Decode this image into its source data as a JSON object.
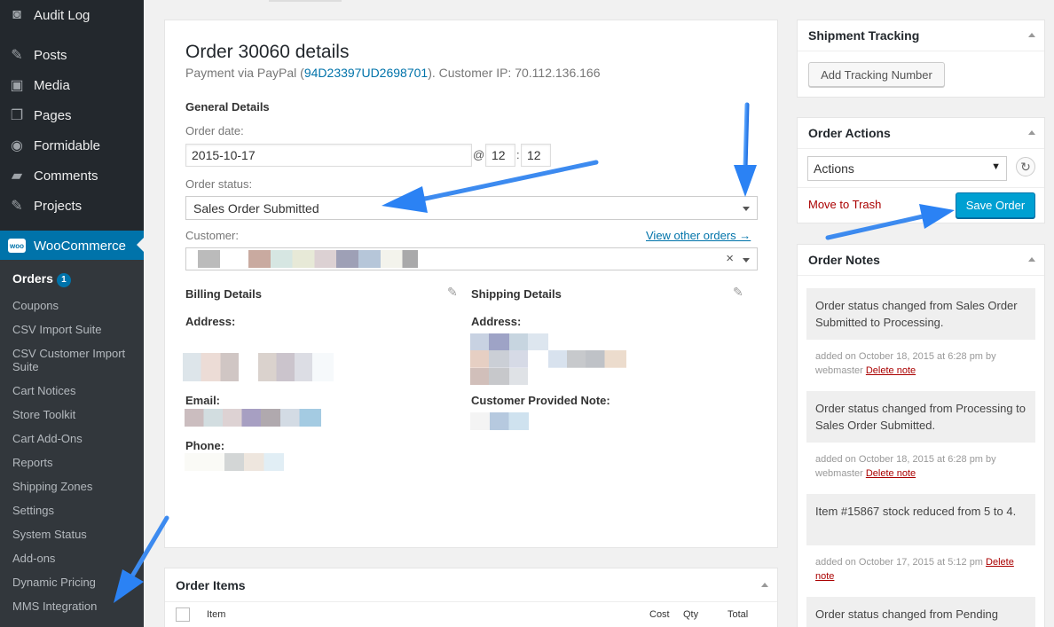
{
  "sidebar": {
    "items": [
      {
        "label": "Audit Log",
        "icon": "audit-log-icon"
      },
      {
        "label": "Posts",
        "icon": "pin-icon"
      },
      {
        "label": "Media",
        "icon": "media-icon"
      },
      {
        "label": "Pages",
        "icon": "pages-icon"
      },
      {
        "label": "Formidable",
        "icon": "formidable-icon"
      },
      {
        "label": "Comments",
        "icon": "comments-icon"
      },
      {
        "label": "Projects",
        "icon": "pin-icon"
      },
      {
        "label": "WooCommerce",
        "icon": "woo-icon"
      }
    ],
    "submenu": [
      {
        "label": "Orders",
        "badge": "1"
      },
      {
        "label": "Coupons"
      },
      {
        "label": "CSV Import Suite"
      },
      {
        "label": "CSV Customer Import Suite"
      },
      {
        "label": "Cart Notices"
      },
      {
        "label": "Store Toolkit"
      },
      {
        "label": "Cart Add-Ons"
      },
      {
        "label": "Reports"
      },
      {
        "label": "Shipping Zones"
      },
      {
        "label": "Settings"
      },
      {
        "label": "System Status"
      },
      {
        "label": "Add-ons"
      },
      {
        "label": "Dynamic Pricing"
      },
      {
        "label": "MMS Integration"
      }
    ]
  },
  "order": {
    "title": "Order 30060 details",
    "payment_prefix": "Payment via PayPal (",
    "payment_txn": "94D23397UD2698701",
    "payment_suffix": "). Customer IP: 70.112.136.166",
    "general_heading": "General Details",
    "order_date_label": "Order date:",
    "order_date": "2015-10-17",
    "at": "@",
    "hour": "12",
    "colon": ":",
    "minute": "12",
    "status_label": "Order status:",
    "status_value": "Sales Order Submitted",
    "customer_label": "Customer:",
    "view_other_orders": "View other orders →",
    "customer_clear": "×",
    "billing_heading": "Billing Details",
    "shipping_heading": "Shipping Details",
    "billing_address_label": "Address:",
    "billing_email_label": "Email:",
    "billing_phone_label": "Phone:",
    "shipping_address_label": "Address:",
    "shipping_note_label": "Customer Provided Note:"
  },
  "order_items": {
    "title": "Order Items",
    "columns": [
      "Item",
      "Cost",
      "Qty",
      "Total"
    ]
  },
  "shipment_tracking": {
    "title": "Shipment Tracking",
    "add_button": "Add Tracking Number"
  },
  "order_actions": {
    "title": "Order Actions",
    "select_value": "Actions",
    "trash_link": "Move to Trash",
    "save_button": "Save Order"
  },
  "order_notes": {
    "title": "Order Notes",
    "notes": [
      {
        "text": "Order status changed from Sales Order Submitted to Processing.",
        "meta": "added on October 18, 2015 at 6:28 pm by webmaster",
        "delete": "Delete note"
      },
      {
        "text": "Order status changed from Processing to Sales Order Submitted.",
        "meta": "added on October 18, 2015 at 6:28 pm by webmaster",
        "delete": "Delete note"
      },
      {
        "text": "Item #15867 stock reduced from 5 to 4.",
        "meta": "added on October 17, 2015 at 5:12 pm",
        "delete": "Delete note"
      },
      {
        "text": "Order status changed from Pending"
      }
    ]
  },
  "colors": {
    "accent": "#0073aa",
    "arrow": "#2b82f4",
    "primary_button": "#00a0d2",
    "trash": "#a00"
  }
}
